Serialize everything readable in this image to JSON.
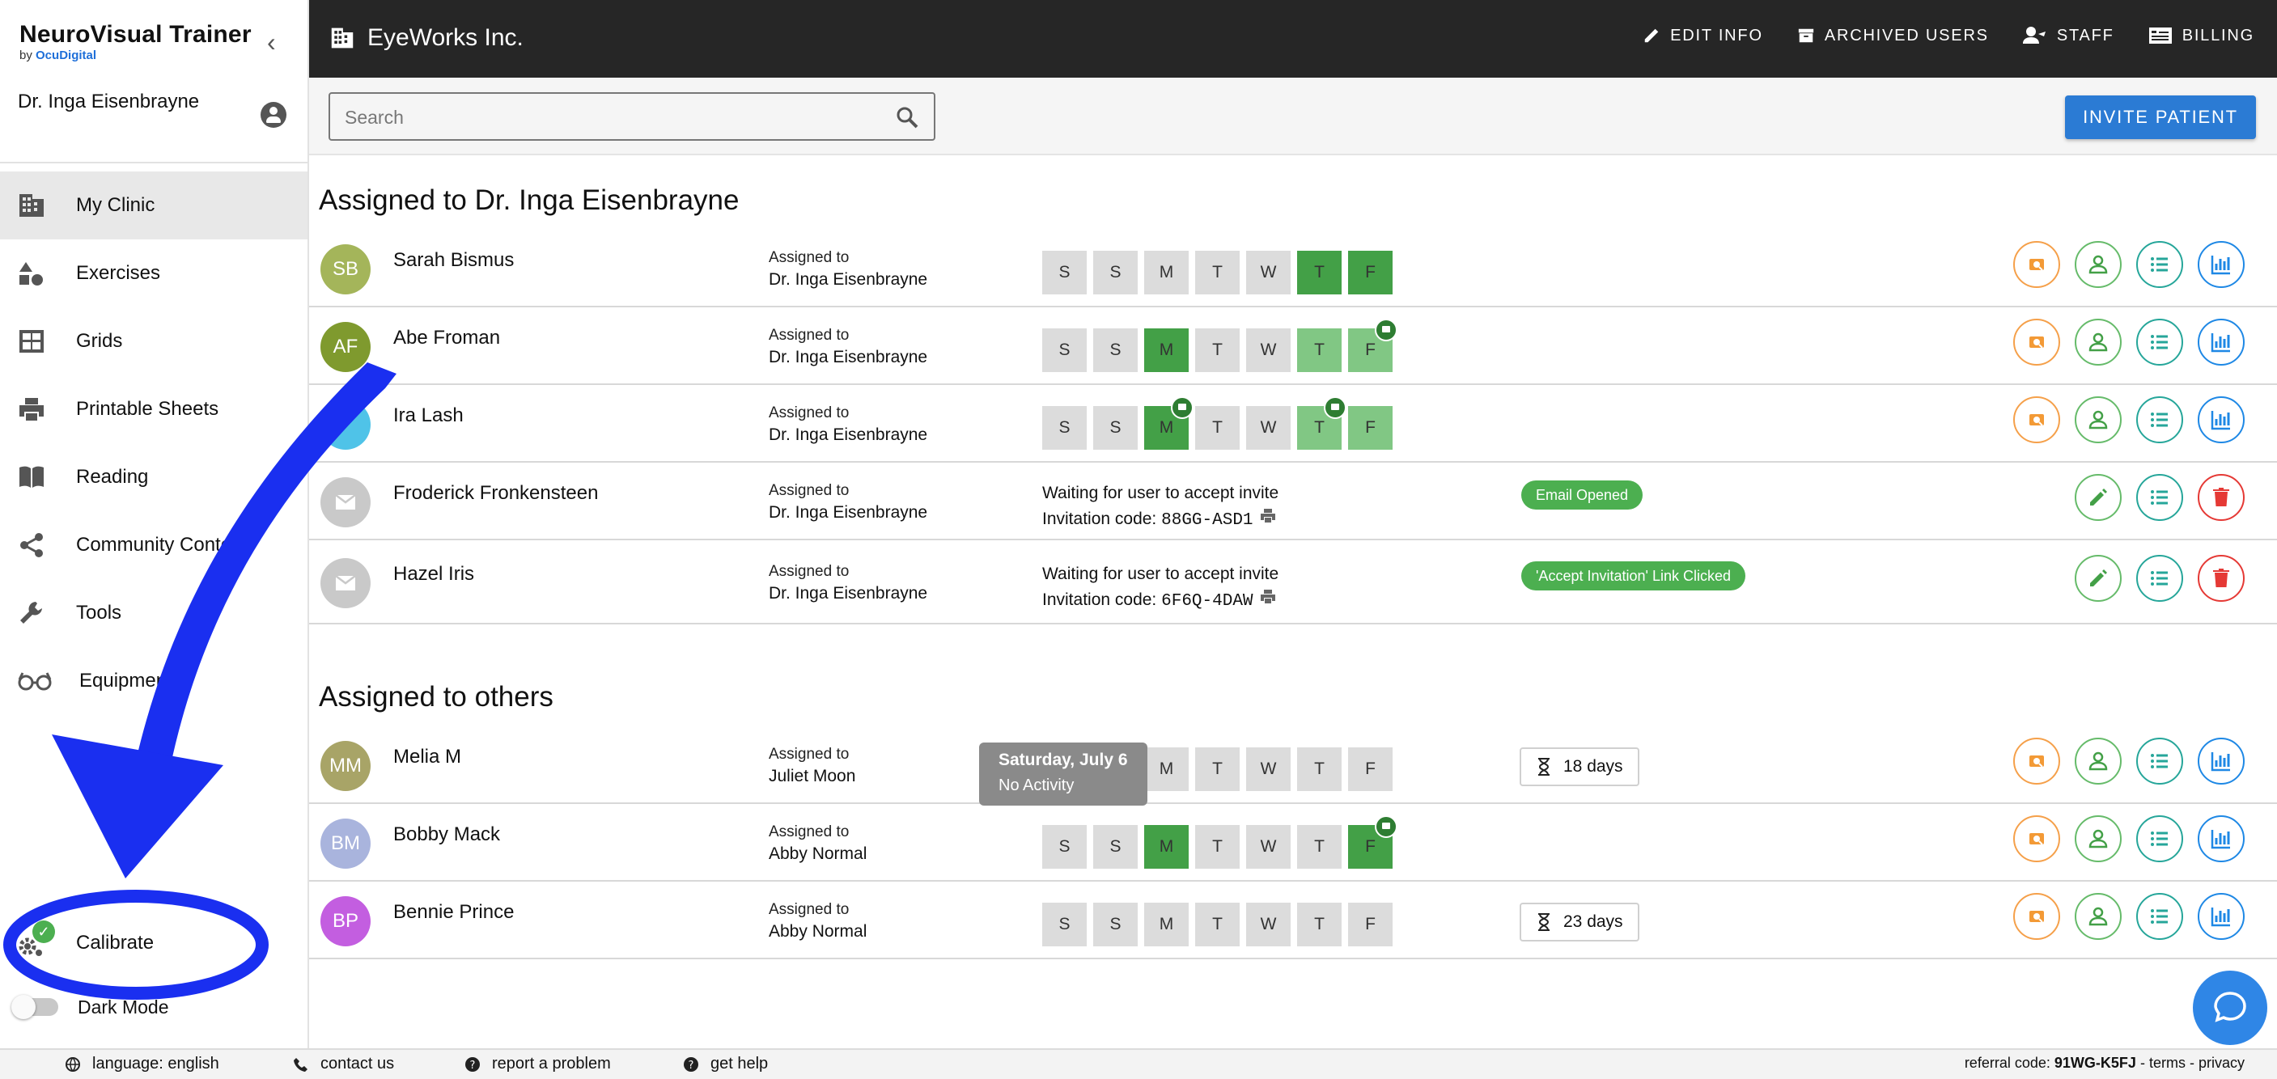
{
  "brand": {
    "title": "NeuroVisual Trainer",
    "by": "by",
    "company": "OcuDigital"
  },
  "user": {
    "name": "Dr. Inga Eisenbrayne"
  },
  "nav": [
    {
      "label": "My Clinic",
      "icon": "building-icon"
    },
    {
      "label": "Exercises",
      "icon": "shapes-icon"
    },
    {
      "label": "Grids",
      "icon": "grid-icon"
    },
    {
      "label": "Printable Sheets",
      "icon": "printer-icon"
    },
    {
      "label": "Reading",
      "icon": "book-icon"
    },
    {
      "label": "Community Conten",
      "icon": "share-icon"
    },
    {
      "label": "Tools",
      "icon": "wrench-icon"
    },
    {
      "label": "Equipmen",
      "icon": "glasses-icon"
    }
  ],
  "calibrate": {
    "label": "Calibrate"
  },
  "dark_mode": {
    "label": "Dark Mode",
    "enabled": false
  },
  "header": {
    "clinic": "EyeWorks Inc.",
    "actions": {
      "edit": "EDIT INFO",
      "archived": "ARCHIVED USERS",
      "staff": "STAFF",
      "billing": "BILLING"
    }
  },
  "search": {
    "placeholder": "Search"
  },
  "invite_label": "INVITE PATIENT",
  "section_mine": {
    "title": "Assigned to Dr. Inga Eisenbrayne"
  },
  "section_others": {
    "title": "Assigned to others"
  },
  "assigned_to_label": "Assigned to",
  "mine": [
    {
      "initials": "SB",
      "name": "Sarah Bismus",
      "assigned": "Dr. Inga Eisenbrayne",
      "avatar": "#a4b55a"
    },
    {
      "initials": "AF",
      "name": "Abe Froman",
      "assigned": "Dr. Inga Eisenbrayne",
      "avatar": "#7f9a2e"
    },
    {
      "initials": "",
      "name": "Ira Lash",
      "assigned": "Dr. Inga Eisenbrayne",
      "avatar": "#4fc3e8"
    },
    {
      "name": "Froderick Fronkensteen",
      "assigned": "Dr. Inga Eisenbrayne",
      "waiting": "Waiting for user to accept invite",
      "code_label": "Invitation code:",
      "code": "88GG-ASD1",
      "status": "Email Opened"
    },
    {
      "name": "Hazel Iris",
      "assigned": "Dr. Inga Eisenbrayne",
      "waiting": "Waiting for user to accept invite",
      "code_label": "Invitation code:",
      "code": "6F6Q-4DAW",
      "status": "'Accept Invitation' Link Clicked"
    }
  ],
  "others": [
    {
      "initials": "MM",
      "name": "Melia M",
      "assigned": "Juliet Moon",
      "avatar": "#a8a467",
      "timer": "18 days"
    },
    {
      "initials": "BM",
      "name": "Bobby Mack",
      "assigned": "Abby Normal",
      "avatar": "#a9b4dd"
    },
    {
      "initials": "BP",
      "name": "Bennie Prince",
      "assigned": "Abby Normal",
      "avatar": "#c35ee0",
      "timer": "23 days"
    }
  ],
  "week": [
    "S",
    "S",
    "M",
    "T",
    "W",
    "T",
    "F"
  ],
  "tooltip": {
    "date": "Saturday, July 6",
    "text": "No Activity"
  },
  "footer": {
    "language": "language: english",
    "contact": "contact us",
    "report": "report a problem",
    "help": "get help",
    "referral_label": "referral code:",
    "referral_code": "91WG-K5FJ",
    "sep1": "-",
    "terms": "terms",
    "sep2": "-",
    "privacy": "privacy"
  },
  "colors": {
    "activity_light": "#81c784",
    "activity_dark": "#43a047",
    "accent": "#2b7bd4",
    "annotation": "#1a2ff0"
  }
}
